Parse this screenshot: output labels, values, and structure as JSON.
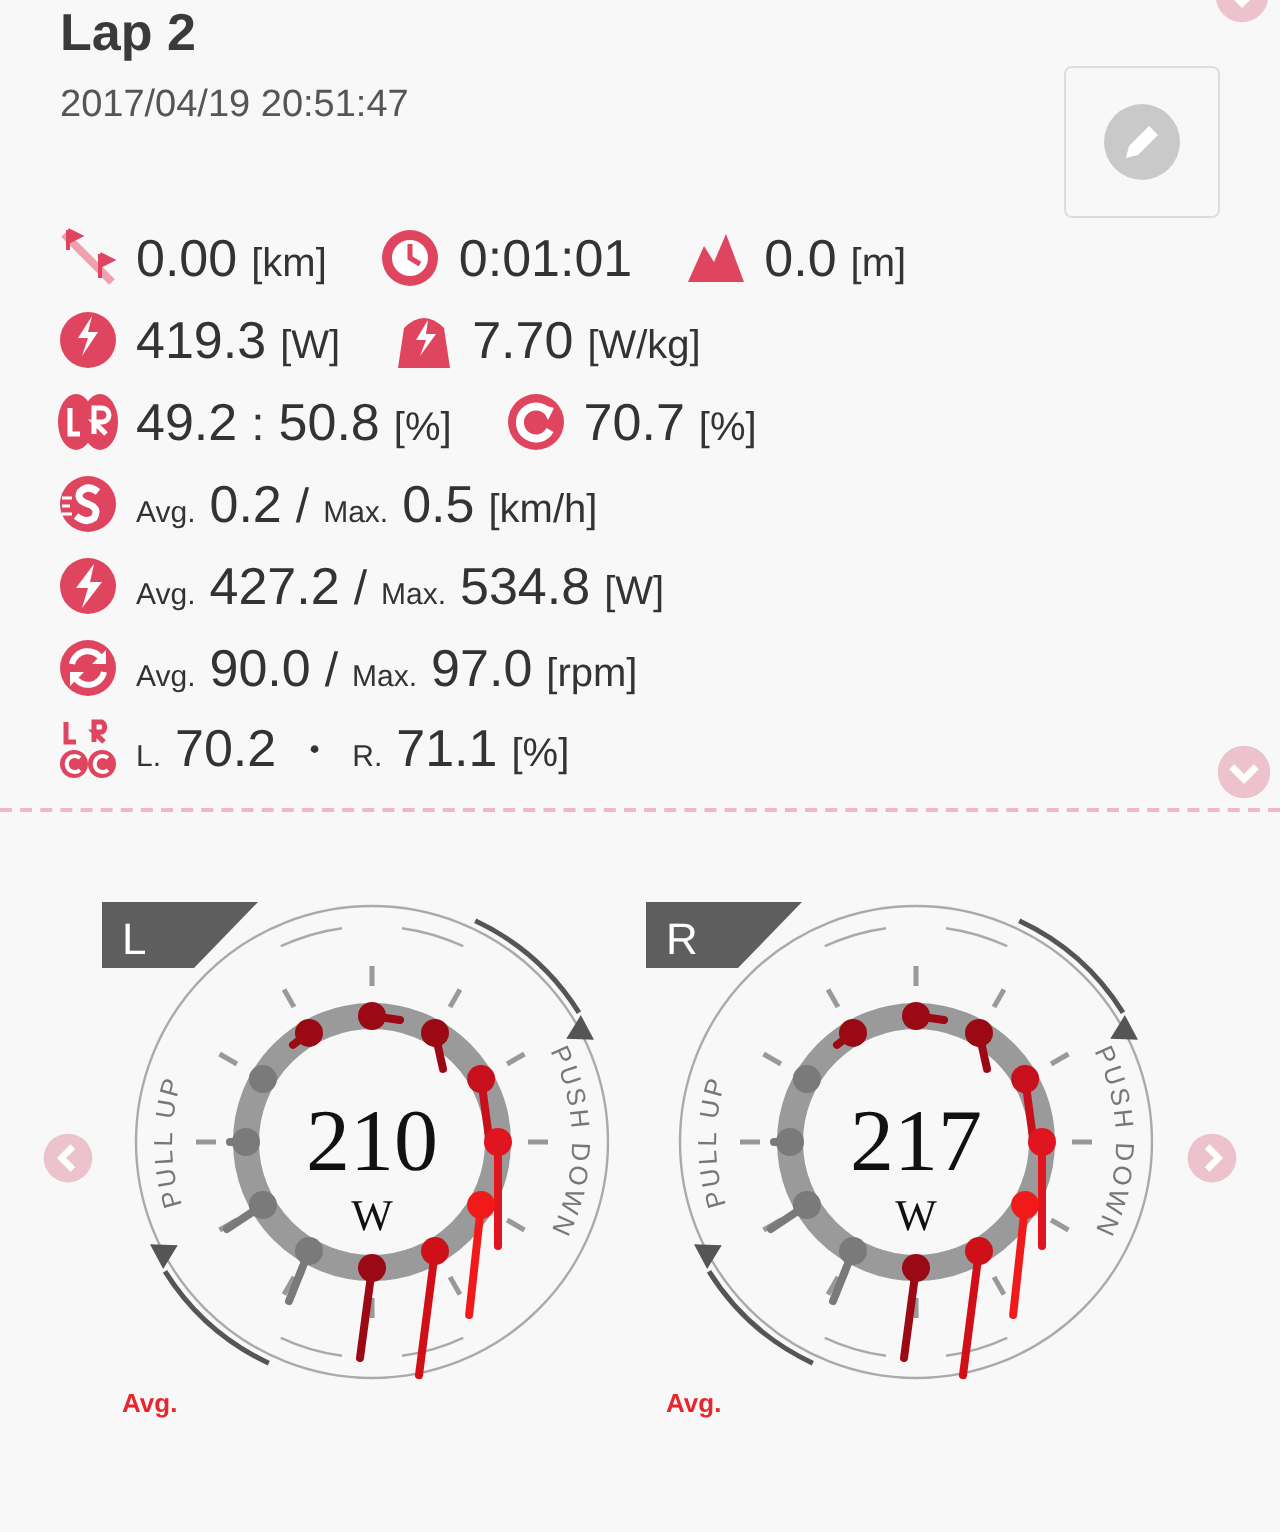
{
  "header": {
    "title": "Lap 2",
    "timestamp": "2017/04/19 20:51:47"
  },
  "stat_rows": [
    {
      "items": [
        {
          "kind": "distance",
          "segments": [
            {
              "kind": "value",
              "text": "0.00"
            },
            {
              "kind": "unit",
              "text": "[km]"
            }
          ]
        },
        {
          "kind": "time",
          "segments": [
            {
              "kind": "value",
              "text": "0:01:01"
            }
          ]
        },
        {
          "kind": "elevation",
          "segments": [
            {
              "kind": "value",
              "text": "0.0"
            },
            {
              "kind": "unit",
              "text": "[m]"
            }
          ]
        }
      ]
    },
    {
      "items": [
        {
          "kind": "np",
          "segments": [
            {
              "kind": "value",
              "text": "419.3"
            },
            {
              "kind": "unit",
              "text": "[W]"
            }
          ]
        },
        {
          "kind": "wkg",
          "segments": [
            {
              "kind": "value",
              "text": "7.70"
            },
            {
              "kind": "unit",
              "text": "[W/kg]"
            }
          ]
        }
      ]
    },
    {
      "items": [
        {
          "kind": "balance",
          "segments": [
            {
              "kind": "value",
              "text": "49.2"
            },
            {
              "kind": "sep",
              "text": ":"
            },
            {
              "kind": "value",
              "text": "50.8"
            },
            {
              "kind": "unit",
              "text": "[%]"
            }
          ]
        },
        {
          "kind": "efficiency",
          "segments": [
            {
              "kind": "value",
              "text": "70.7"
            },
            {
              "kind": "unit",
              "text": "[%]"
            }
          ]
        }
      ]
    },
    {
      "items": [
        {
          "kind": "speed",
          "segments": [
            {
              "kind": "small",
              "text": "Avg."
            },
            {
              "kind": "value",
              "text": "0.2"
            },
            {
              "kind": "sep",
              "text": "/"
            },
            {
              "kind": "small",
              "text": "Max."
            },
            {
              "kind": "value",
              "text": "0.5"
            },
            {
              "kind": "unit",
              "text": "[km/h]"
            }
          ]
        }
      ]
    },
    {
      "items": [
        {
          "kind": "power",
          "segments": [
            {
              "kind": "small",
              "text": "Avg."
            },
            {
              "kind": "value",
              "text": "427.2"
            },
            {
              "kind": "sep",
              "text": "/"
            },
            {
              "kind": "small",
              "text": "Max."
            },
            {
              "kind": "value",
              "text": "534.8"
            },
            {
              "kind": "unit",
              "text": "[W]"
            }
          ]
        }
      ]
    },
    {
      "items": [
        {
          "kind": "cadence",
          "segments": [
            {
              "kind": "small",
              "text": "Avg."
            },
            {
              "kind": "value",
              "text": "90.0"
            },
            {
              "kind": "sep",
              "text": "/"
            },
            {
              "kind": "small",
              "text": "Max."
            },
            {
              "kind": "value",
              "text": "97.0"
            },
            {
              "kind": "unit",
              "text": "[rpm]"
            }
          ]
        }
      ]
    },
    {
      "items": [
        {
          "kind": "lr_efficiency",
          "segments": [
            {
              "kind": "small",
              "text": "L."
            },
            {
              "kind": "value",
              "text": "70.2"
            },
            {
              "kind": "sep",
              "text": "・"
            },
            {
              "kind": "small",
              "text": "R."
            },
            {
              "kind": "value",
              "text": "71.1"
            },
            {
              "kind": "unit",
              "text": "[%]"
            }
          ]
        }
      ]
    }
  ],
  "gauges": [
    {
      "tag": "L",
      "value": "210",
      "unit": "W",
      "left_label": "PULL UP",
      "right_label": "PUSH DOWN",
      "footer": "Avg."
    },
    {
      "tag": "R",
      "value": "217",
      "unit": "W",
      "left_label": "PULL UP",
      "right_label": "PUSH DOWN",
      "footer": "Avg."
    }
  ]
}
